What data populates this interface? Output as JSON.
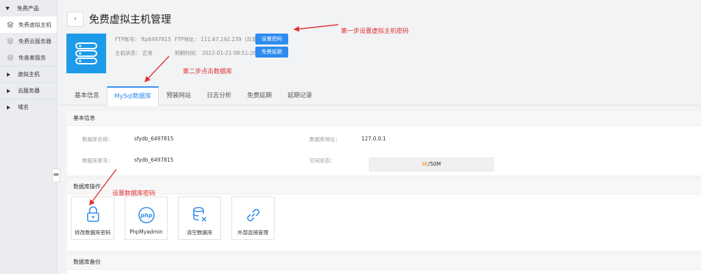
{
  "sidebar": {
    "items": [
      {
        "label": "免费产品",
        "type": "group-open",
        "icon": "arrow-down"
      },
      {
        "label": "免费虚拟主机",
        "type": "sub",
        "icon": "layers-icon",
        "active": true
      },
      {
        "label": "免费云服务器",
        "type": "sub",
        "icon": "layers-icon"
      },
      {
        "label": "免备案服务",
        "type": "sub",
        "icon": "layers-icon"
      },
      {
        "label": "虚拟主机",
        "type": "group",
        "icon": "arrow-right"
      },
      {
        "label": "云服务器",
        "type": "group",
        "icon": "arrow-right"
      },
      {
        "label": "域名",
        "type": "group",
        "icon": "arrow-right"
      }
    ],
    "collapse_glyph": "⇹"
  },
  "header": {
    "back_glyph": "‹",
    "title": "免费虚拟主机管理",
    "ftp_account": "FTP账号：  ftp6497815",
    "ftp_address": "FTP地址：  111.67.192.239（共享）",
    "host_status": "主机状态：  正常",
    "expire_time": "到期时间：  2022-01-21 08:51:26",
    "set_password_btn": "设置密码",
    "extend_btn": "免费延期"
  },
  "annotations": {
    "step1": "第一步设置虚拟主机密码",
    "step2": "第二步点击数据库",
    "set_db_pwd": "设置数据库密码"
  },
  "tabs": [
    "基本信息",
    "MySql数据库",
    "预装网站",
    "日志分析",
    "免费延期",
    "延期记录"
  ],
  "active_tab": 1,
  "db_info": {
    "heading": "基本信息",
    "name_label": "数据库名称：",
    "name_value": "sfydb_6497815",
    "address_label": "数据库地址：",
    "address_value": "127.0.0.1",
    "account_label": "数据库账号：",
    "account_value": "sfydb_6497815",
    "space_label": "空间状态：",
    "space_used": "4K",
    "space_total": "/50M"
  },
  "db_ops": {
    "heading": "数据库操作",
    "cards": [
      {
        "label": "修改数据库密码",
        "icon": "lock-icon"
      },
      {
        "label": "PhpMyadmin",
        "icon": "php-icon"
      },
      {
        "label": "清空数据库",
        "icon": "database-clear-icon"
      },
      {
        "label": "外部连接管理",
        "icon": "link-icon"
      }
    ]
  },
  "db_backup": {
    "heading": "数据库备份"
  },
  "colors": {
    "accent": "#2d8cf0",
    "annotation": "#e03030",
    "server_icon_bg": "#1e9be8",
    "usage_highlight": "#f08a24"
  }
}
